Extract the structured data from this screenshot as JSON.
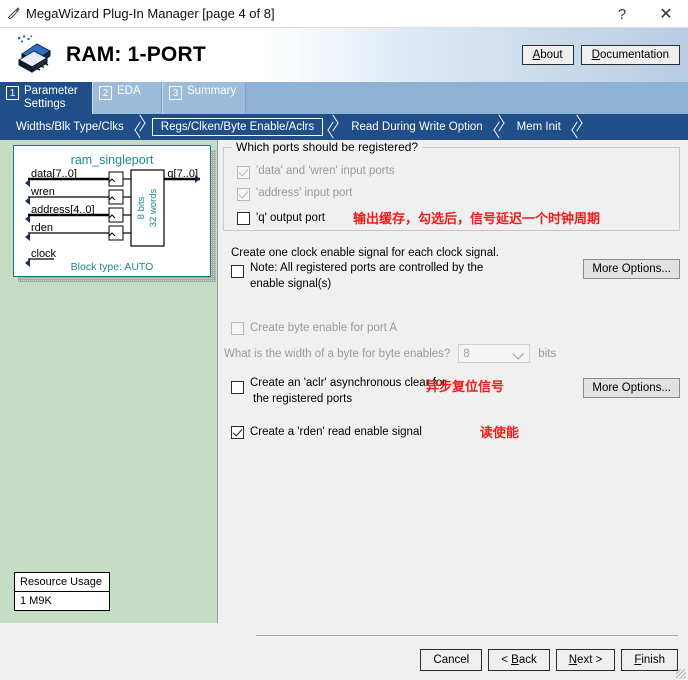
{
  "titlebar": {
    "icon": "wand-icon",
    "title": "MegaWizard Plug-In Manager [page 4 of 8]",
    "help_label": "?",
    "close_label": "✕"
  },
  "header": {
    "product_title": "RAM: 1-PORT",
    "about_label": "About",
    "about_mnemonic": "A",
    "documentation_label": "Documentation",
    "documentation_mnemonic": "D"
  },
  "tabs": [
    {
      "num": "1",
      "label": "Parameter Settings",
      "active": true
    },
    {
      "num": "2",
      "label": "EDA",
      "active": false
    },
    {
      "num": "3",
      "label": "Summary",
      "active": false
    }
  ],
  "breadcrumbs": [
    {
      "label": "Widths/Blk Type/Clks",
      "selected": false
    },
    {
      "label": "Regs/Clken/Byte Enable/Aclrs",
      "selected": true
    },
    {
      "label": "Read During Write Option",
      "selected": false
    },
    {
      "label": "Mem Init",
      "selected": false
    }
  ],
  "diagram": {
    "title": "ram_singleport",
    "inputs": [
      "data[7..0]",
      "wren",
      "address[4..0]",
      "rden",
      "clock"
    ],
    "output": "q[7..0]",
    "mem_line1": "8 bits",
    "mem_line2": "32 words",
    "block_type": "Block type: AUTO"
  },
  "resource_usage": {
    "header": "Resource Usage",
    "value": "1 M9K"
  },
  "registered_ports": {
    "legend": "Which ports should be registered?",
    "items": [
      {
        "label": "'data' and 'wren' input ports",
        "checked": true,
        "disabled": true
      },
      {
        "label": "'address' input port",
        "checked": true,
        "disabled": true
      },
      {
        "label": "'q' output port",
        "checked": false,
        "disabled": false,
        "note": "输出缓存，勾选后，信号延迟一个时钟周期"
      }
    ]
  },
  "clock_enable": {
    "line1": "Create one clock enable signal for each clock signal.",
    "line2": "Note: All registered ports are controlled by the",
    "line3": "enable signal(s)",
    "checked": false,
    "more_options_label": "More Options..."
  },
  "byte_enable": {
    "label": "Create byte enable for port A",
    "checked": false,
    "disabled": true,
    "width_question": "What is the width of a byte for byte enables?",
    "width_value": "8",
    "width_unit": "bits"
  },
  "aclr": {
    "line1": "Create an 'aclr' asynchronous clear for",
    "line2": "the registered ports",
    "checked": false,
    "note": "异步复位信号",
    "more_options_label": "More Options..."
  },
  "rden": {
    "label": "Create a 'rden' read enable signal",
    "checked": true,
    "note": "读使能"
  },
  "footer": {
    "buttons": [
      {
        "label": "Cancel",
        "mnemonic": ""
      },
      {
        "label": "< Back",
        "mnemonic": "B"
      },
      {
        "label": "Next >",
        "mnemonic": "N"
      },
      {
        "label": "Finish",
        "mnemonic": "F"
      }
    ]
  },
  "colors": {
    "navy": "#1f4e88",
    "tab_idle": "#9dbcda",
    "left_panel_green": "#c5ddc5",
    "diagram_teal": "#147a7a",
    "annotation_red": "#ee1c1c"
  }
}
